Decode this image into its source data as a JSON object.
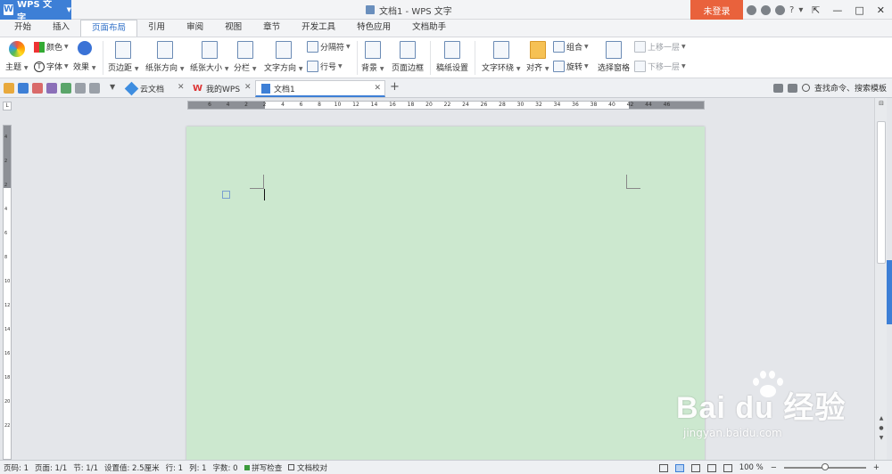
{
  "app": {
    "logo_letter": "W",
    "name": "WPS 文字",
    "window_title": "文档1 - WPS 文字",
    "login_label": "未登录"
  },
  "menu_tabs": [
    "开始",
    "插入",
    "页面布局",
    "引用",
    "审阅",
    "视图",
    "章节",
    "开发工具",
    "特色应用",
    "文档助手"
  ],
  "active_tab": "页面布局",
  "ribbon": {
    "theme": "主题",
    "colors": "颜色",
    "font": "字体",
    "effects": "效果",
    "margins": "页边距",
    "orientation": "纸张方向",
    "size": "纸张大小",
    "columns": "分栏",
    "text_direction": "文字方向",
    "breaks": "分隔符",
    "line_numbers": "行号",
    "background": "背景",
    "page_border": "页面边框",
    "manuscript": "稿纸设置",
    "wrap_text": "文字环绕",
    "align": "对齐",
    "group": "组合",
    "rotate": "旋转",
    "selection_pane": "选择窗格",
    "bring_forward": "上移一层",
    "send_backward": "下移一层"
  },
  "doc_tabs": [
    {
      "label": "云文档",
      "icon": "cloud-icon"
    },
    {
      "label": "我的WPS",
      "icon": "wps-logo-icon"
    },
    {
      "label": "文档1",
      "icon": "document-icon",
      "active": true
    }
  ],
  "search_command": "查找命令、搜索模板",
  "ruler": {
    "h_ticks": [
      "6",
      "4",
      "2",
      "2",
      "4",
      "6",
      "8",
      "10",
      "12",
      "14",
      "16",
      "18",
      "20",
      "22",
      "24",
      "26",
      "28",
      "30",
      "32",
      "34",
      "36",
      "38",
      "40",
      "42",
      "44",
      "46"
    ],
    "v_ticks": [
      "4",
      "2",
      "2",
      "4",
      "6",
      "8",
      "10",
      "12",
      "14",
      "16",
      "18",
      "20",
      "22"
    ]
  },
  "watermark": {
    "logo": "Bai du 经验",
    "url": "jingyan.baidu.com"
  },
  "status": {
    "page_code": "页码: 1",
    "pages": "页面: 1/1",
    "section": "节: 1/1",
    "setting_value": "设置值: 2.5厘米",
    "row": "行: 1",
    "column": "列: 1",
    "word_count": "字数: 0",
    "spell_check": "拼写检查",
    "doc_proof": "文档校对",
    "zoom": "100 %",
    "zoom_fraction": 0.5
  },
  "colors": {
    "accent": "#3d7fd6",
    "login": "#e9623c",
    "page_bg": "#cce8cf"
  }
}
